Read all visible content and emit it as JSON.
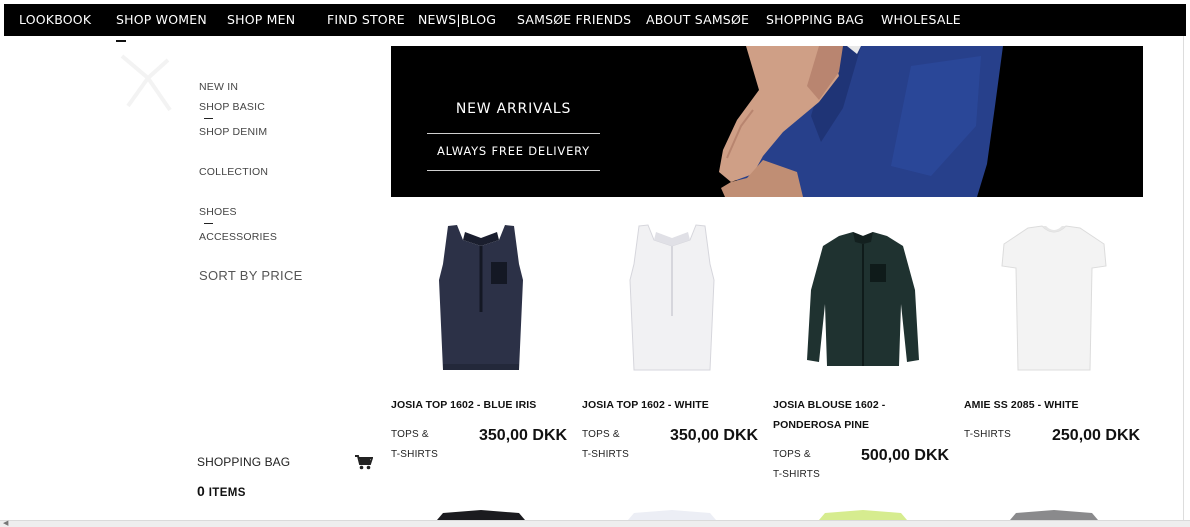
{
  "topnav": {
    "items": [
      {
        "label": "LOOKBOOK"
      },
      {
        "label": "SHOP WOMEN"
      },
      {
        "label": "SHOP MEN"
      },
      {
        "label": "FIND STORE"
      },
      {
        "label": "NEWS|BLOG"
      },
      {
        "label": "SAMSØE FRIENDS"
      },
      {
        "label": "ABOUT SAMSØE"
      },
      {
        "label": "SHOPPING BAG"
      },
      {
        "label": "WHOLESALE"
      }
    ]
  },
  "sidebar": {
    "links": [
      {
        "label": "NEW IN"
      },
      {
        "label": "SHOP BASIC"
      },
      {
        "label": "SHOP DENIM"
      },
      {
        "label": "COLLECTION"
      },
      {
        "label": "SHOES"
      },
      {
        "label": "ACCESSORIES"
      }
    ],
    "sort_label": "SORT BY PRICE"
  },
  "bag": {
    "label": "SHOPPING BAG",
    "count": "0",
    "unit": "ITEMS"
  },
  "banner": {
    "line1": "NEW ARRIVALS",
    "line2": "ALWAYS FREE DELIVERY"
  },
  "products": [
    {
      "name": "JOSIA TOP 1602 - BLUE IRIS",
      "category_1": "TOPS &",
      "category_2": "T-SHIRTS",
      "price": "350,00 DKK",
      "color": "#2c3147"
    },
    {
      "name": "JOSIA TOP 1602 - WHITE",
      "category_1": "TOPS &",
      "category_2": "T-SHIRTS",
      "price": "350,00 DKK",
      "color": "#f1f1f3"
    },
    {
      "name_line1": "JOSIA BLOUSE 1602 -",
      "name_line2": "PONDEROSA PINE",
      "category_1": "TOPS &",
      "category_2": "T-SHIRTS",
      "price": "500,00 DKK",
      "color": "#1f3230"
    },
    {
      "name": "AMIE SS 2085 - WHITE",
      "category_1": "T-SHIRTS",
      "price": "250,00 DKK",
      "color": "#f3f3f3"
    }
  ],
  "colors": {
    "nav_bg": "#000000",
    "banner_bg": "#000000",
    "text": "#111111"
  }
}
